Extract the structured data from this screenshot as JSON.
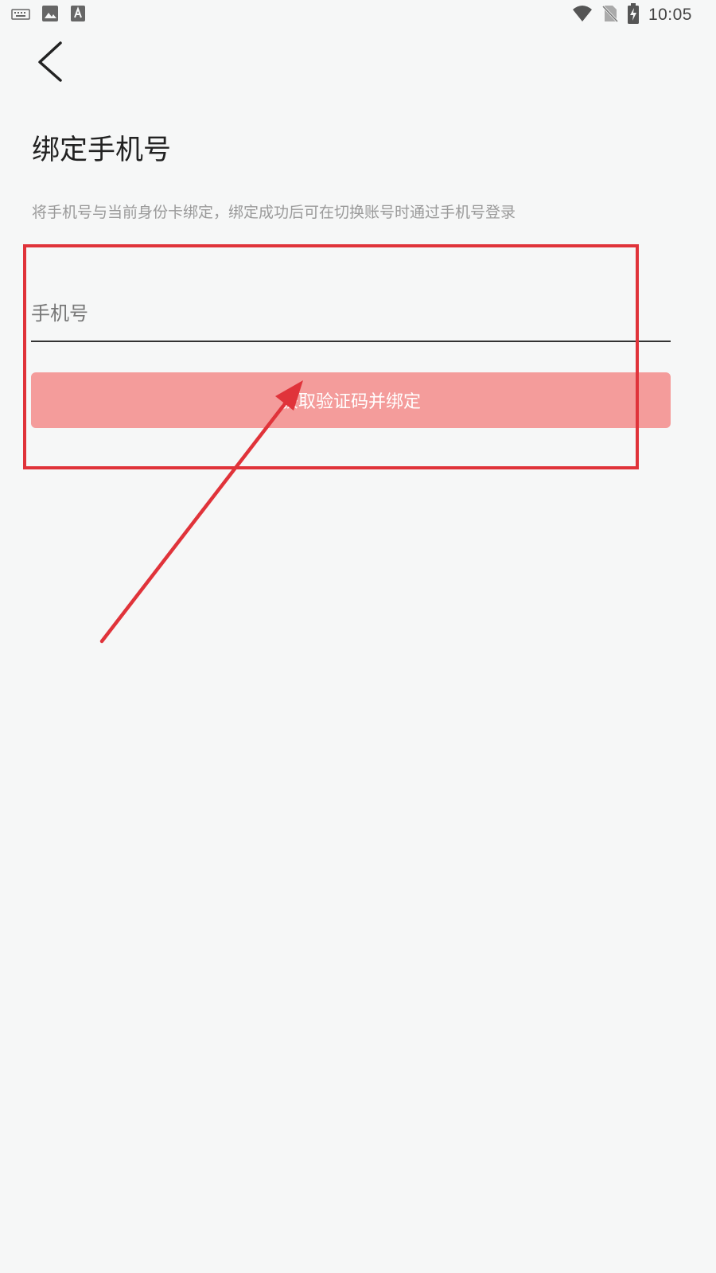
{
  "status_bar": {
    "time": "10:05",
    "left_icons": [
      "keyboard-icon",
      "image-icon",
      "font-icon"
    ],
    "right_icons": [
      "wifi-icon",
      "no-sim-icon",
      "battery-charging-icon"
    ]
  },
  "nav": {
    "back_icon": "chevron-left-icon"
  },
  "page": {
    "title": "绑定手机号",
    "subtitle": "将手机号与当前身份卡绑定，绑定成功后可在切换账号时通过手机号登录"
  },
  "form": {
    "phone_placeholder": "手机号",
    "phone_value": "",
    "submit_label": "获取验证码并绑定"
  },
  "colors": {
    "button_bg": "#f49c9b",
    "annotation": "#e0333a",
    "background": "#f6f7f7"
  }
}
